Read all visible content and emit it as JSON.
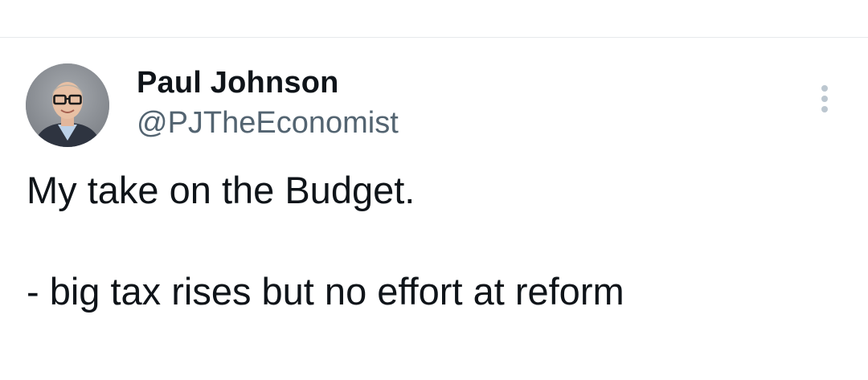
{
  "tweet": {
    "author": {
      "display_name": "Paul Johnson",
      "handle": "@PJTheEconomist"
    },
    "text": "My take on the Budget.\n\n- big tax rises but no effort at reform"
  },
  "icons": {
    "more": "more-vertical-icon",
    "avatar": "avatar"
  },
  "colors": {
    "text_primary": "#0f1419",
    "text_secondary": "#536471",
    "icon_muted": "#bcc7d0",
    "divider": "#e6e9ec"
  }
}
